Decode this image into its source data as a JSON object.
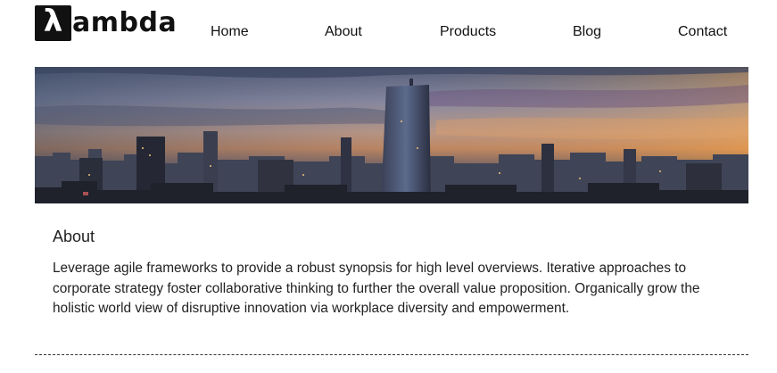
{
  "header": {
    "logo": {
      "mark": "λ",
      "text": "ambda"
    },
    "nav": [
      {
        "label": "Home"
      },
      {
        "label": "About"
      },
      {
        "label": "Products"
      },
      {
        "label": "Blog"
      },
      {
        "label": "Contact"
      }
    ]
  },
  "banner": {
    "description_icon": "city-skyline-image"
  },
  "about": {
    "title": "About",
    "body": "Leverage agile frameworks to provide a robust synopsis for high level overviews. Iterative approaches to corporate strategy foster collaborative thinking to further the overall value proposition. Organically grow the holistic world view of disruptive innovation via workplace diversity and empowerment."
  },
  "colors": {
    "text": "#222222",
    "logo": "#111111",
    "background": "#ffffff"
  }
}
